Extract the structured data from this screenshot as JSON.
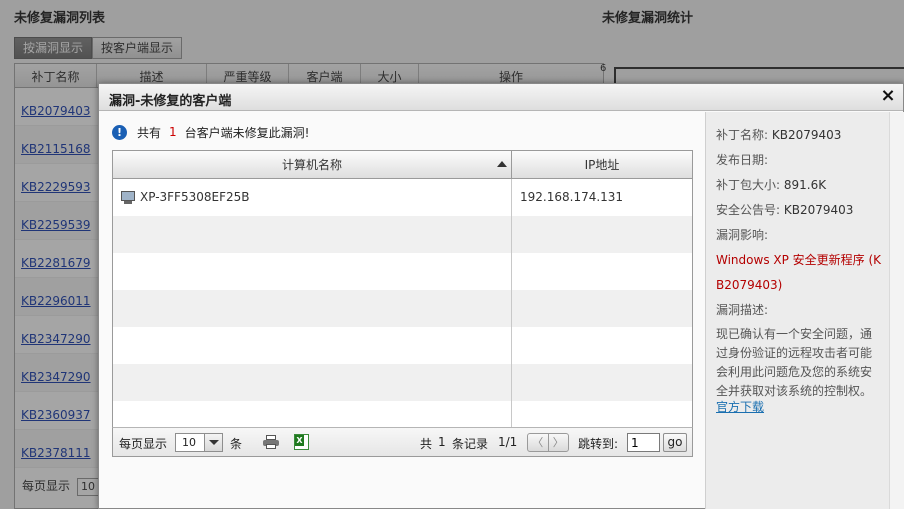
{
  "background": {
    "left_title": "未修复漏洞列表",
    "right_title": "未修复漏洞统计",
    "tabs": [
      "按漏洞显示",
      "按客户端显示"
    ],
    "columns": [
      "补丁名称",
      "描述",
      "严重等级",
      "客户端",
      "大小",
      "操作"
    ],
    "rows": [
      "KB2079403",
      "KB2115168",
      "KB2229593",
      "KB2259539",
      "KB2281679",
      "KB2296011",
      "KB2347290",
      "KB2347290",
      "KB2360937",
      "KB2378111"
    ],
    "footer_label": "每页显示",
    "footer_value": "10",
    "chart_axis_value": "6"
  },
  "dialog": {
    "title": "漏洞-未修复的客户端",
    "notice": {
      "prefix": "共有",
      "count": "1",
      "suffix": "台客户端未修复此漏洞!"
    },
    "grid": {
      "columns": [
        "计算机名称",
        "IP地址"
      ],
      "rows": [
        {
          "name": "XP-3FF5308EF25B",
          "ip": "192.168.174.131"
        }
      ]
    },
    "footer": {
      "page_size_label": "每页显示",
      "page_size_value": "10",
      "page_size_unit": "条",
      "total_prefix": "共",
      "total_count": "1",
      "total_suffix": "条记录",
      "page_indicator": "1/1",
      "prev_symbol": "〈",
      "next_symbol": "〉",
      "goto_label": "跳转到:",
      "goto_value": "1",
      "go_label": "go"
    },
    "details": {
      "patch_name_label": "补丁名称:",
      "patch_name_value": "KB2079403",
      "publish_date_label": "发布日期:",
      "package_size_label": "补丁包大小:",
      "package_size_value": "891.6K",
      "bulletin_label": "安全公告号:",
      "bulletin_value": "KB2079403",
      "impact_label": "漏洞影响:",
      "impact_value": "Windows XP 安全更新程序 (KB2079403)",
      "description_label": "漏洞描述:",
      "description_value": "现已确认有一个安全问题，通过身份验证的远程攻击者可能会利用此问题危及您的系统安全并获取对该系统的控制权。",
      "download_link": "官方下载"
    }
  }
}
